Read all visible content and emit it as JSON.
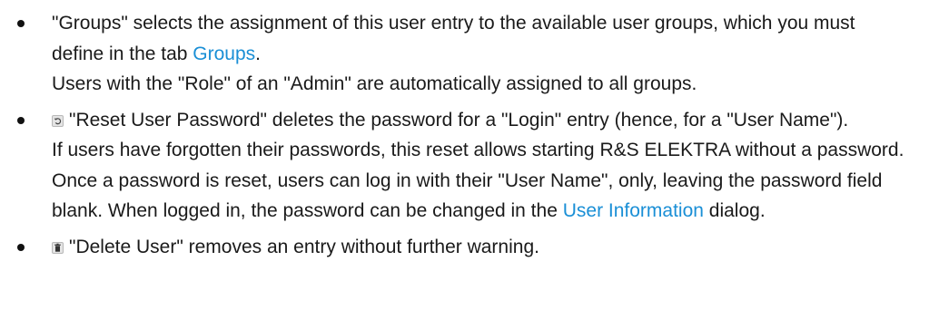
{
  "items": [
    {
      "part1": "\"Groups\" selects the assignment of this user entry to the available user groups, which you must define in the tab ",
      "link": "Groups",
      "part2": ".",
      "line2": "Users with the \"Role\" of an \"Admin\" are automatically assigned to all groups."
    },
    {
      "icon": "reset-icon",
      "text1": "\"Reset User Password\" deletes the password for a \"Login\" entry (hence, for a \"User Name\").",
      "part1": "If users have forgotten their passwords, this reset allows starting R&S ELEKTRA without a password. Once a password is reset, users can log in with their \"User Name\", only, leaving the password field blank. When logged in, the password can be changed in the ",
      "link": "User Information",
      "part2": " dialog."
    },
    {
      "icon": "trash-icon",
      "text1": "\"Delete User\" removes an entry without further warning."
    }
  ],
  "colors": {
    "link": "#1a8fd6",
    "text": "#1a1a1a"
  }
}
